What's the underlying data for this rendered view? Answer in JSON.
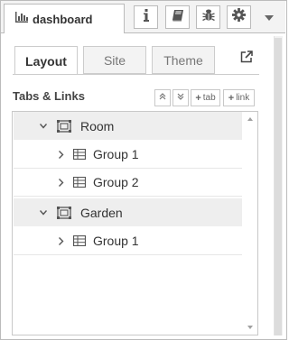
{
  "header": {
    "sidebar_tab_label": "dashboard",
    "buttons": [
      {
        "name": "info-icon"
      },
      {
        "name": "book-icon"
      },
      {
        "name": "bug-icon"
      },
      {
        "name": "gear-icon"
      }
    ]
  },
  "subtabs": {
    "layout": "Layout",
    "site": "Site",
    "theme": "Theme"
  },
  "section": {
    "title": "Tabs & Links",
    "tab_button": "tab",
    "link_button": "link"
  },
  "tree": {
    "rows": [
      {
        "type": "tab",
        "label": "Room"
      },
      {
        "type": "group",
        "label": "Group 1"
      },
      {
        "type": "group",
        "label": "Group 2"
      },
      {
        "type": "tab",
        "label": "Garden"
      },
      {
        "type": "group",
        "label": "Group 1"
      }
    ]
  },
  "colors": {
    "accent": "#333333",
    "border": "#bbbbbb",
    "tab_row_bg": "#eeeeee"
  }
}
